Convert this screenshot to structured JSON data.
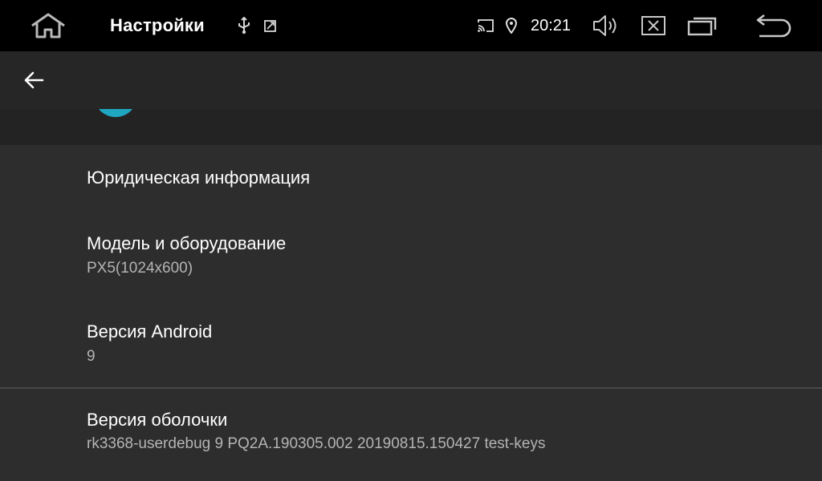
{
  "statusbar": {
    "title": "Настройки",
    "time": "20:21",
    "icons": [
      "home-icon",
      "usb-icon",
      "screenshot-icon",
      "cast-icon",
      "location-icon",
      "volume-icon",
      "close-app-icon",
      "recent-apps-icon",
      "back-nav-icon"
    ]
  },
  "appbar": {
    "back_icon": "arrow-left-icon"
  },
  "list": {
    "items": [
      {
        "title": "Юридическая информация",
        "subtitle": ""
      },
      {
        "title": "Модель и оборудование",
        "subtitle": "PX5(1024x600)"
      },
      {
        "title": "Версия Android",
        "subtitle": "9"
      },
      {
        "title": "Версия оболочки",
        "subtitle": "rk3368-userdebug 9 PQ2A.190305.002 20190815.150427 test-keys"
      }
    ]
  },
  "colors": {
    "statusbar_bg": "#000000",
    "appbar_bg": "#262626",
    "list_bg": "#2d2d2d",
    "accent_teal": "#1fa7c1",
    "secondary_text": "#b4b4b4"
  }
}
